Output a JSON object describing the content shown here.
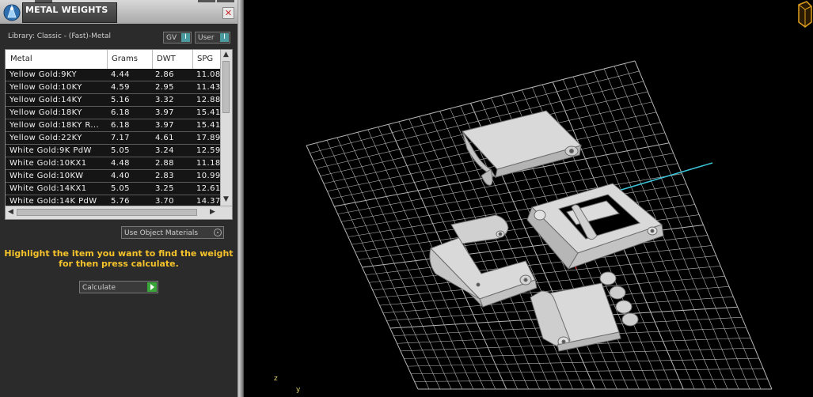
{
  "panel": {
    "title": "METAL WEIGHTS",
    "close_glyph": "✕",
    "library_label": "Library: Classic - (Fast)-Metal",
    "toggles": [
      {
        "label": "GV",
        "indicator": "I"
      },
      {
        "label": "User",
        "indicator": "I"
      }
    ],
    "table": {
      "columns": [
        "Metal",
        "Grams",
        "DWT",
        "SPG"
      ],
      "rows": [
        [
          "Yellow Gold:9KY",
          "4.44",
          "2.86",
          "11.08"
        ],
        [
          "Yellow Gold:10KY",
          "4.59",
          "2.95",
          "11.43"
        ],
        [
          "Yellow Gold:14KY",
          "5.16",
          "3.32",
          "12.88"
        ],
        [
          "Yellow Gold:18KY",
          "6.18",
          "3.97",
          "15.41"
        ],
        [
          "Yellow Gold:18KY R...",
          "6.18",
          "3.97",
          "15.41"
        ],
        [
          "Yellow Gold:22KY",
          "7.17",
          "4.61",
          "17.89"
        ],
        [
          "White Gold:9K PdW",
          "5.05",
          "3.24",
          "12.59"
        ],
        [
          "White Gold:10KX1",
          "4.48",
          "2.88",
          "11.18"
        ],
        [
          "White Gold:10KW",
          "4.40",
          "2.83",
          "10.99"
        ],
        [
          "White Gold:14KX1",
          "5.05",
          "3.25",
          "12.61"
        ],
        [
          "White Gold:14K PdW",
          "5.76",
          "3.70",
          "14.37"
        ]
      ]
    },
    "use_object_materials": "Use Object Materials",
    "hint_line1": "Highlight the item you want to find the weight",
    "hint_line2": "for then press calculate.",
    "calculate_label": "Calculate"
  },
  "viewport": {
    "axis_z": "z",
    "axis_y": "y",
    "grid_color": "#b4b4b4",
    "model_color": "#d9d9d9"
  }
}
